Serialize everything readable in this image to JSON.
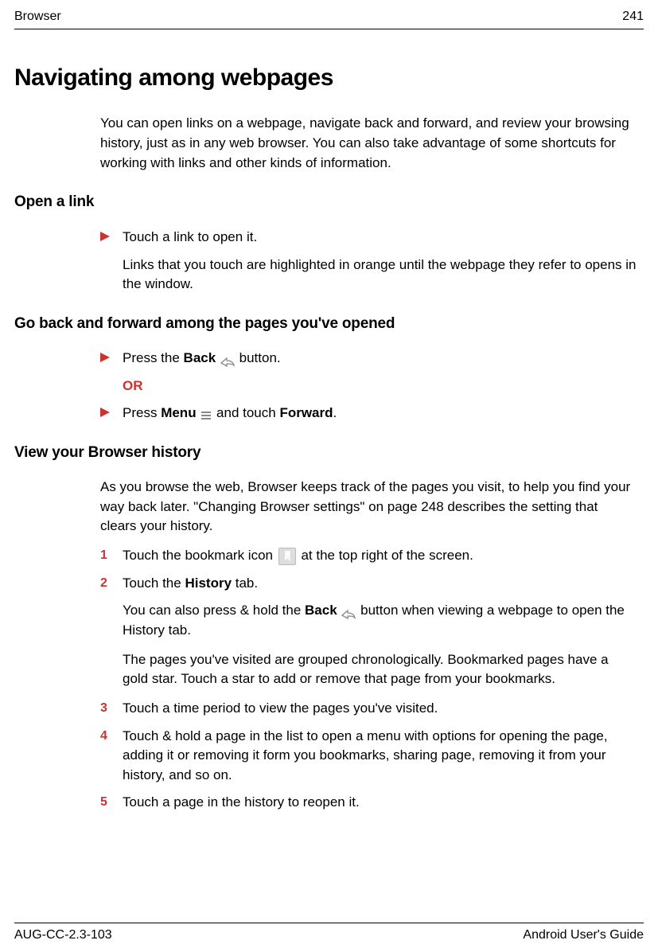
{
  "header": {
    "section": "Browser",
    "pageNumber": "241"
  },
  "title": "Navigating among webpages",
  "intro": "You can open links on a webpage, navigate back and forward, and review your browsing history, just as in any web browser. You can also take advantage of some shortcuts for working with links and other kinds of information.",
  "sections": {
    "openLink": {
      "heading": "Open a link",
      "bullet1": "Touch a link to open it.",
      "sub1": "Links that you touch are highlighted in orange until the webpage they refer to opens in the window."
    },
    "goBack": {
      "heading": "Go back and forward among the pages you've opened",
      "bullet1_a": "Press the ",
      "bullet1_b": "Back",
      "bullet1_c": " button.",
      "or": "OR",
      "bullet2_a": "Press ",
      "bullet2_b": "Menu",
      "bullet2_c": " and touch ",
      "bullet2_d": "Forward",
      "bullet2_e": "."
    },
    "history": {
      "heading": "View your Browser history",
      "intro": "As you browse the web, Browser keeps track of the pages you visit, to help you find your way back later. \"Changing Browser settings\" on page 248 describes the setting that clears your history.",
      "step1_a": "Touch the bookmark icon ",
      "step1_b": " at the top right of the screen.",
      "step2_a": "Touch the ",
      "step2_b": "History",
      "step2_c": " tab.",
      "step2_sub1_a": "You can also press & hold the ",
      "step2_sub1_b": "Back",
      "step2_sub1_c": " button when viewing a webpage to open the History tab.",
      "step2_sub2": "The pages you've visited are grouped chronologically. Bookmarked pages have a gold star. Touch a star to add or remove that page from your bookmarks.",
      "step3": "Touch a time period to view the pages you've visited.",
      "step4": "Touch & hold a page in the list to open a menu with options for opening the page, adding it or removing it form you bookmarks, sharing page, removing it from your history, and so on.",
      "step5": "Touch a page in the history to reopen it."
    }
  },
  "footer": {
    "left": "AUG-CC-2.3-103",
    "right": "Android User's Guide"
  }
}
